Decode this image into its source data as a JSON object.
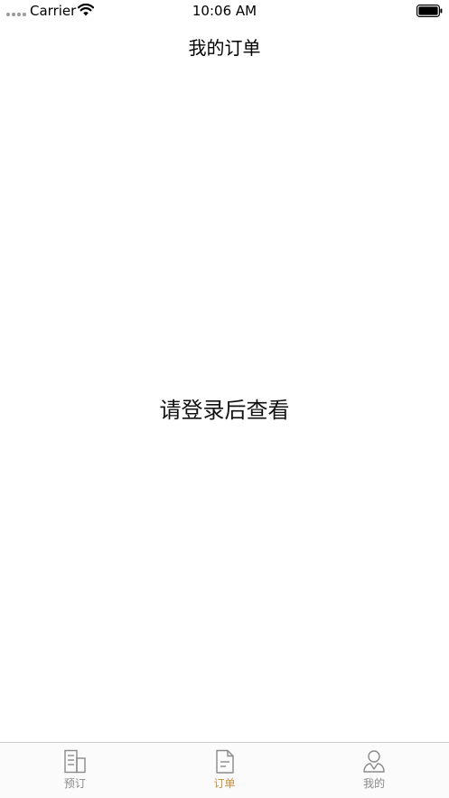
{
  "status_bar": {
    "carrier": "Carrier",
    "time": "10:06 AM"
  },
  "nav": {
    "title": "我的订单"
  },
  "main": {
    "message": "请登录后查看"
  },
  "tab_bar": {
    "active_index": 1,
    "active_color": "#c8903f",
    "inactive_color": "#8a8a8a",
    "tabs": [
      {
        "label": "预订",
        "icon": "booking-icon"
      },
      {
        "label": "订单",
        "icon": "order-icon"
      },
      {
        "label": "我的",
        "icon": "profile-icon"
      }
    ]
  }
}
